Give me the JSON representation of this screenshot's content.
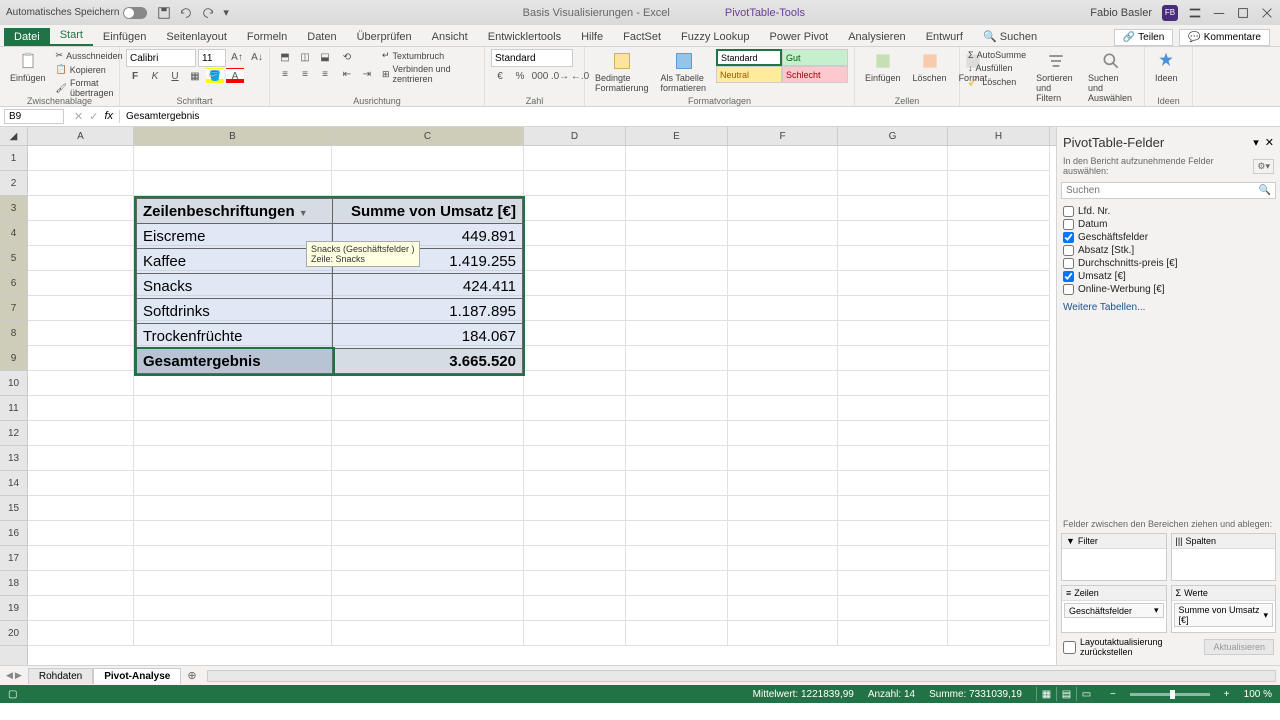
{
  "titlebar": {
    "autosave": "Automatisches Speichern",
    "doc_name": "Basis Visualisierungen",
    "app_suffix": "Excel",
    "context_tab": "PivotTable-Tools",
    "user": "Fabio Basler",
    "user_initials": "FB"
  },
  "menu": {
    "file": "Datei",
    "tabs": [
      "Start",
      "Einfügen",
      "Seitenlayout",
      "Formeln",
      "Daten",
      "Überprüfen",
      "Ansicht",
      "Entwicklertools",
      "Hilfe",
      "FactSet",
      "Fuzzy Lookup",
      "Power Pivot",
      "Analysieren",
      "Entwurf"
    ],
    "search": "Suchen",
    "share": "Teilen",
    "comments": "Kommentare"
  },
  "ribbon": {
    "clipboard": {
      "paste": "Einfügen",
      "cut": "Ausschneiden",
      "copy": "Kopieren",
      "format": "Format übertragen",
      "label": "Zwischenablage"
    },
    "font": {
      "name": "Calibri",
      "size": "11",
      "label": "Schriftart"
    },
    "align": {
      "wrap": "Textumbruch",
      "merge": "Verbinden und zentrieren",
      "label": "Ausrichtung"
    },
    "number": {
      "format": "Standard",
      "label": "Zahl"
    },
    "styles": {
      "cond": "Bedingte Formatierung",
      "table": "Als Tabelle formatieren",
      "standard": "Standard",
      "gut": "Gut",
      "neutral": "Neutral",
      "schlecht": "Schlecht",
      "label": "Formatvorlagen"
    },
    "cells": {
      "insert": "Einfügen",
      "delete": "Löschen",
      "format": "Format",
      "label": "Zellen"
    },
    "edit": {
      "sum": "AutoSumme",
      "fill": "Ausfüllen",
      "clear": "Löschen",
      "sort": "Sortieren und Filtern",
      "find": "Suchen und Auswählen"
    },
    "ideas": {
      "label": "Ideen"
    }
  },
  "formula": {
    "cell": "B9",
    "value": "Gesamtergebnis"
  },
  "grid": {
    "cols": [
      "A",
      "B",
      "C",
      "D",
      "E",
      "F",
      "G",
      "H"
    ],
    "tooltip": {
      "line1": "Snacks (Geschäftsfelder )",
      "line2": "Zeile: Snacks"
    }
  },
  "pivot": {
    "headers": [
      "Zeilenbeschriftungen",
      "Summe von Umsatz [€]"
    ],
    "rows": [
      {
        "label": "Eiscreme",
        "value": "449.891"
      },
      {
        "label": "Kaffee",
        "value": "1.419.255"
      },
      {
        "label": "Snacks",
        "value": "424.411"
      },
      {
        "label": "Softdrinks",
        "value": "1.187.895"
      },
      {
        "label": "Trockenfrüchte",
        "value": "184.067"
      }
    ],
    "total": {
      "label": "Gesamtergebnis",
      "value": "3.665.520"
    }
  },
  "fieldpane": {
    "title": "PivotTable-Felder",
    "subtitle": "In den Bericht aufzunehmende Felder auswählen:",
    "search_ph": "Suchen",
    "fields": [
      {
        "name": "Lfd. Nr.",
        "checked": false
      },
      {
        "name": "Datum",
        "checked": false
      },
      {
        "name": "Geschäftsfelder",
        "checked": true
      },
      {
        "name": "Absatz [Stk.]",
        "checked": false
      },
      {
        "name": "Durchschnitts-preis [€]",
        "checked": false
      },
      {
        "name": "Umsatz [€]",
        "checked": true
      },
      {
        "name": "Online-Werbung [€]",
        "checked": false
      }
    ],
    "more": "Weitere Tabellen...",
    "drag_hint": "Felder zwischen den Bereichen ziehen und ablegen:",
    "areas": {
      "filter": "Filter",
      "cols": "Spalten",
      "rows": "Zeilen",
      "values": "Werte"
    },
    "row_pill": "Geschäftsfelder",
    "val_pill": "Summe von Umsatz [€]",
    "defer": "Layoutaktualisierung zurückstellen",
    "update": "Aktualisieren"
  },
  "sheets": {
    "tabs": [
      "Rohdaten",
      "Pivot-Analyse"
    ],
    "active": 1
  },
  "status": {
    "avg_lbl": "Mittelwert:",
    "avg": "1221839,99",
    "count_lbl": "Anzahl:",
    "count": "14",
    "sum_lbl": "Summe:",
    "sum": "7331039,19",
    "zoom": "100 %"
  }
}
